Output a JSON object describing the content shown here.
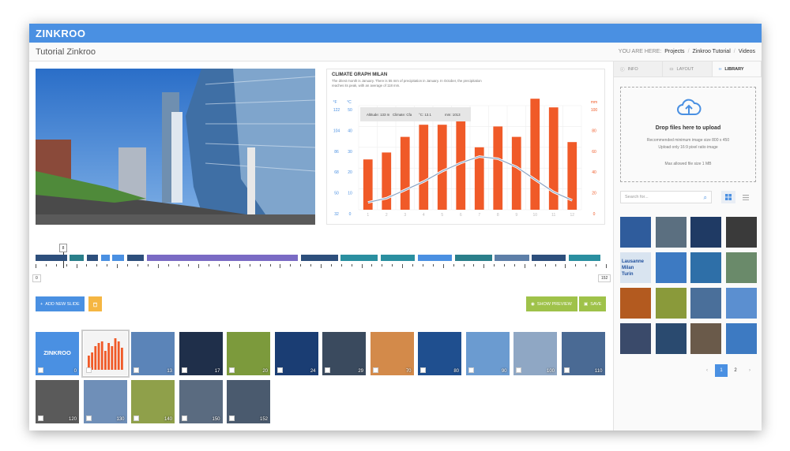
{
  "app": {
    "logo": "ZINKROO"
  },
  "header": {
    "page_title": "Tutorial Zinkroo",
    "crumbs_prefix": "YOU ARE HERE:",
    "crumbs": [
      "Projects",
      "Zinkroo Tutorial",
      "Videos"
    ]
  },
  "chart": {
    "title": "CLIMATE GRAPH MILAN",
    "description": "The driest month is January. There is 55 mm of precipitation in January. In October, the precipitation reaches its peak, with an average of 118 mm.",
    "info": [
      "Altitude: 133 m",
      "Climate: Cfa",
      "°C: 13.1",
      "mm: 1013"
    ],
    "left_unit_f": "°F",
    "left_unit_c": "°C",
    "right_unit": "mm",
    "f_ticks": [
      "122",
      "104",
      "86",
      "68",
      "50",
      "32"
    ],
    "c_ticks": [
      "50",
      "40",
      "30",
      "20",
      "10",
      "0"
    ],
    "mm_ticks": [
      "100",
      "80",
      "60",
      "40",
      "20",
      "0"
    ]
  },
  "chart_data": {
    "type": "bar",
    "title": "CLIMATE GRAPH MILAN",
    "categories": [
      "1",
      "2",
      "3",
      "4",
      "5",
      "6",
      "7",
      "8",
      "9",
      "10",
      "11",
      "12"
    ],
    "series": [
      {
        "values": [
          58,
          66,
          84,
          98,
          98,
          102,
          72,
          96,
          84,
          128,
          118,
          78
        ]
      },
      {
        "values": [
          2,
          4,
          8,
          12,
          17,
          21,
          24,
          23,
          19,
          13,
          7,
          3
        ]
      }
    ],
    "ylim": [
      0,
      120
    ],
    "grid": true
  },
  "timeline": {
    "handle_value": "8",
    "min": "0",
    "max": "152",
    "segments": [
      {
        "start": 0.0,
        "end": 0.055,
        "color": "#2d4f7c"
      },
      {
        "start": 0.06,
        "end": 0.085,
        "color": "#2a7f8a"
      },
      {
        "start": 0.09,
        "end": 0.11,
        "color": "#2d4f7c"
      },
      {
        "start": 0.115,
        "end": 0.13,
        "color": "#4a90e2"
      },
      {
        "start": 0.135,
        "end": 0.155,
        "color": "#4a90e2"
      },
      {
        "start": 0.16,
        "end": 0.19,
        "color": "#2d4f7c"
      },
      {
        "start": 0.195,
        "end": 0.46,
        "color": "#7a6bc4"
      },
      {
        "start": 0.465,
        "end": 0.53,
        "color": "#2d4f7c"
      },
      {
        "start": 0.535,
        "end": 0.6,
        "color": "#2a8fa0"
      },
      {
        "start": 0.605,
        "end": 0.665,
        "color": "#2a8fa0"
      },
      {
        "start": 0.67,
        "end": 0.73,
        "color": "#4a90e2"
      },
      {
        "start": 0.735,
        "end": 0.8,
        "color": "#2a7f8a"
      },
      {
        "start": 0.805,
        "end": 0.865,
        "color": "#5d7fa8"
      },
      {
        "start": 0.87,
        "end": 0.93,
        "color": "#2d4f7c"
      },
      {
        "start": 0.935,
        "end": 0.99,
        "color": "#2a8fa0"
      }
    ]
  },
  "toolbar": {
    "add_label": "ADD NEW SLIDE",
    "preview_label": "SHOW PREVIEW",
    "save_label": "SAVE"
  },
  "slides": [
    {
      "num": "0",
      "label": "ZINKROO",
      "bg": "#4a90e2"
    },
    {
      "num": "",
      "bg": "#f4f4f4"
    },
    {
      "num": "13",
      "bg": "#5b84b8"
    },
    {
      "num": "17",
      "bg": "#1f2f4a"
    },
    {
      "num": "20",
      "bg": "#7c9a3c"
    },
    {
      "num": "24",
      "bg": "#1a3d73"
    },
    {
      "num": "29",
      "bg": "#3a4a5e"
    },
    {
      "num": "70",
      "bg": "#d38a4a"
    },
    {
      "num": "80",
      "bg": "#1f4f8f"
    },
    {
      "num": "90",
      "bg": "#6b9bd0"
    },
    {
      "num": "100",
      "bg": "#8fa7c4"
    },
    {
      "num": "110",
      "bg": "#4a6a94"
    },
    {
      "num": "120",
      "bg": "#5a5a5a"
    },
    {
      "num": "130",
      "bg": "#6f8fb8"
    },
    {
      "num": "140",
      "bg": "#8fa04a"
    },
    {
      "num": "150",
      "bg": "#5a6b80"
    },
    {
      "num": "152",
      "bg": "#4a5a6e"
    }
  ],
  "sidebar": {
    "tabs": [
      "INFO",
      "LAYOUT",
      "LIBRARY"
    ],
    "drop_title": "Drop files here to upload",
    "drop_lines": [
      "Recommended minimum image size 800 x 450",
      "Upload only 16:9 pixel ratio image",
      "Max allowed file size 1 MB"
    ],
    "search_placeholder": "Search for...",
    "library": [
      {
        "bg": "#2f5c9c"
      },
      {
        "bg": "#5b6f80"
      },
      {
        "bg": "#1f3a64"
      },
      {
        "bg": "#3a3a3a"
      },
      {
        "bg": "#d9e4f0",
        "text": "Lausanne\nMilan\nTurin"
      },
      {
        "bg": "#3d7ac2"
      },
      {
        "bg": "#2e6fa8"
      },
      {
        "bg": "#6a8a6a"
      },
      {
        "bg": "#b35a1f"
      },
      {
        "bg": "#8a9a3a"
      },
      {
        "bg": "#4a6f9a"
      },
      {
        "bg": "#5b8fd0"
      },
      {
        "bg": "#3a4a6a"
      },
      {
        "bg": "#2a4a6f"
      },
      {
        "bg": "#6a5a4a"
      },
      {
        "bg": "#3d7ac2"
      }
    ],
    "pages": [
      "1",
      "2"
    ],
    "prev": "‹",
    "next": "›"
  },
  "colors": {
    "accent": "#4a90e2",
    "bar": "#f05a28",
    "green": "#9fc24a",
    "yellow": "#f5b642"
  }
}
